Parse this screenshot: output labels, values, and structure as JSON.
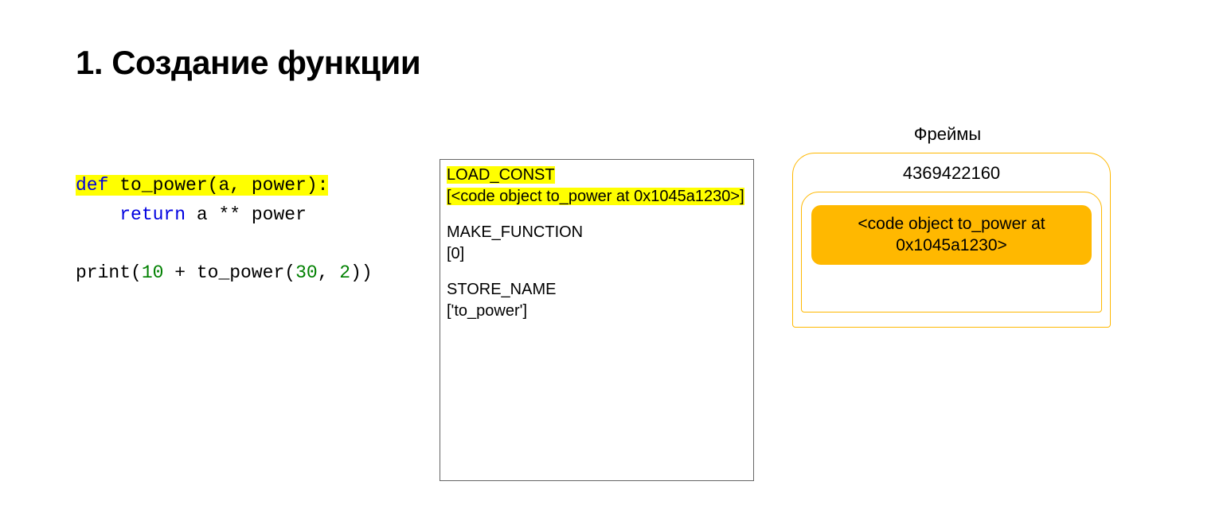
{
  "title": "1. Создание функции",
  "code": {
    "def": "def",
    "fn_decl": " to_power(a, power)",
    "colon": ":",
    "return_kw": "return",
    "return_expr": " a ** power",
    "print_prefix": "print(",
    "ten": "10",
    "plus": " + to_power(",
    "thirty": "30",
    "comma": ", ",
    "two": "2",
    "print_suffix": "))"
  },
  "bytecode": {
    "op1": "LOAD_CONST",
    "arg1a": "[",
    "arg1b": "<code object to_power at 0x1045a1230>",
    "arg1c": "]",
    "op2": "MAKE_FUNCTION",
    "arg2": "[0]",
    "op3": "STORE_NAME",
    "arg3": "['to_power']"
  },
  "frames": {
    "label": "Фреймы",
    "frame_id": "4369422160",
    "stack_top": "<code object to_power at 0x1045a1230>"
  }
}
